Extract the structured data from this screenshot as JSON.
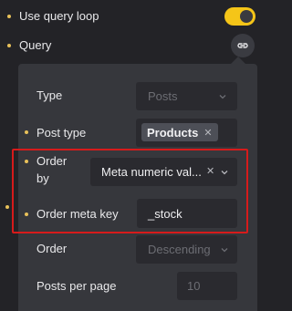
{
  "top": {
    "use_query_loop_label": "Use query loop",
    "query_label": "Query"
  },
  "panel": {
    "type": {
      "label": "Type",
      "value": "Posts"
    },
    "post_type": {
      "label": "Post type",
      "chip": "Products"
    },
    "order_by": {
      "label_line1": "Order",
      "label_line2": "by",
      "value": "Meta numeric val..."
    },
    "order_meta_key": {
      "label": "Order meta key",
      "value": "_stock"
    },
    "order": {
      "label": "Order",
      "value": "Descending"
    },
    "posts_per_page": {
      "label": "Posts per page",
      "value": "10"
    }
  },
  "icons": {
    "link": "link-icon",
    "chevron": "chevron-down-icon",
    "clear": "close-icon"
  },
  "colors": {
    "background": "#232327",
    "panel": "#36373c",
    "field": "#2a2a2f",
    "accent": "#f5c518",
    "indicator_dot": "#e8c15a",
    "highlight": "#d71b1b"
  }
}
